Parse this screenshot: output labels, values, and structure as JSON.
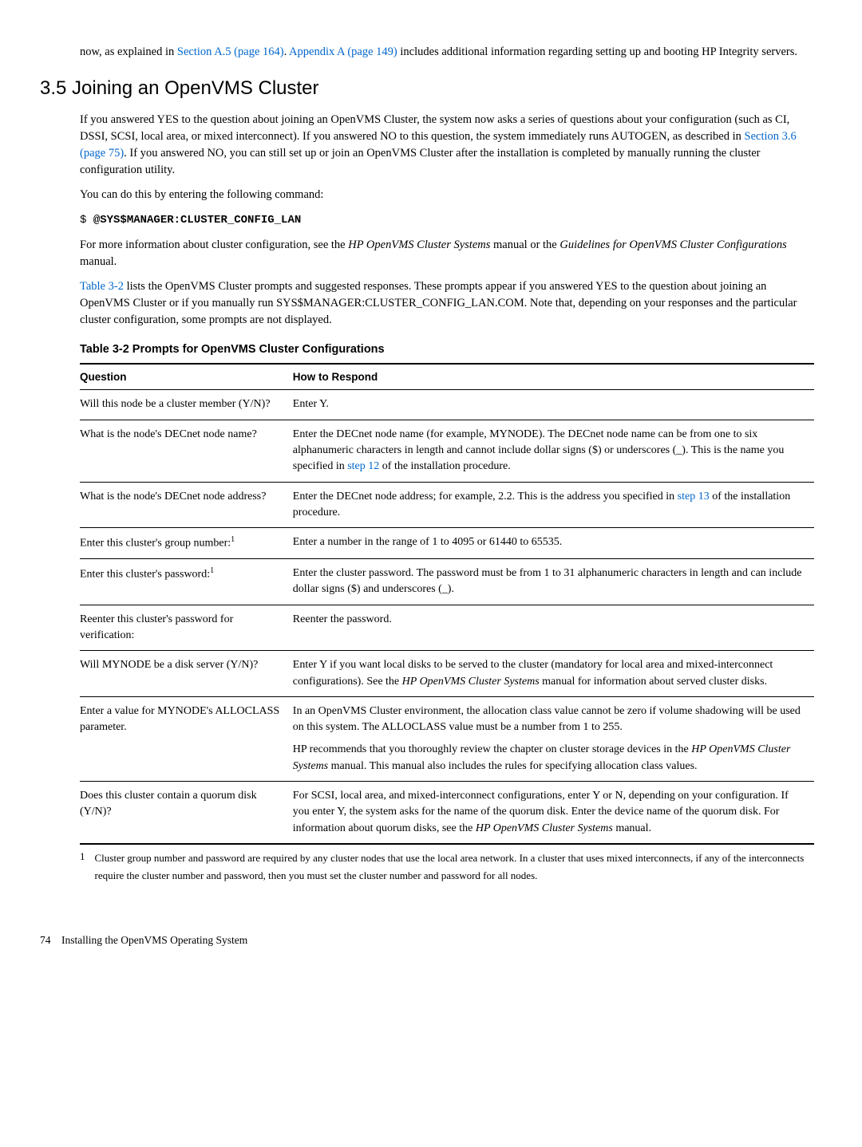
{
  "intro_top": {
    "t1": "now, as explained in ",
    "link1": "Section A.5 (page 164)",
    "t2": ". ",
    "link2": "Appendix A (page 149)",
    "t3": " includes additional information regarding setting up and booting HP Integrity servers."
  },
  "section": {
    "title": "3.5 Joining an OpenVMS Cluster",
    "p1_a": "If you answered YES to the question about joining an OpenVMS Cluster, the system now asks a series of questions about your configuration (such as CI, DSSI, SCSI, local area, or mixed interconnect). If you answered NO to this question, the system immediately runs AUTOGEN, as described in ",
    "p1_link": "Section 3.6 (page 75)",
    "p1_b": ". If you answered NO, you can still set up or join an OpenVMS Cluster after the installation is completed by manually running the cluster configuration utility.",
    "p2": "You  can do this by entering the following command:",
    "cmd_prompt": "$ ",
    "cmd_bold": "@SYS$MANAGER:CLUSTER_CONFIG_LAN",
    "p3_a": "For more information about cluster configuration, see the ",
    "p3_em1": "HP OpenVMS Cluster Systems",
    "p3_b": " manual or the ",
    "p3_em2": "Guidelines for OpenVMS Cluster Configurations",
    "p3_c": " manual.",
    "p4_link": "Table 3-2",
    "p4_a": " lists the OpenVMS Cluster prompts and suggested responses. These prompts appear if you answered YES to the question about joining an OpenVMS Cluster or if you manually run SYS$MANAGER:CLUSTER_CONFIG_LAN.COM. Note that, depending on your responses and the particular cluster configuration, some prompts are not displayed."
  },
  "table": {
    "title": "Table  3-2  Prompts for OpenVMS Cluster Configurations",
    "head_q": "Question",
    "head_r": "How to Respond",
    "rows": [
      {
        "q": "Will this node be a cluster member (Y/N)?",
        "r": "Enter Y."
      },
      {
        "q": "What is the node's DECnet node name?",
        "r_a": "Enter the DECnet node name (for example, MYNODE). The DECnet node name can be from one to six alphanumeric characters in length and cannot include dollar signs ($) or underscores (_). This is the name you specified in ",
        "r_link": "step 12",
        "r_b": " of the installation procedure."
      },
      {
        "q": "What is the node's DECnet node address?",
        "r_a": "Enter the DECnet node address; for example, 2.2. This is the address you specified in ",
        "r_link": "step 13",
        "r_b": " of the installation procedure."
      },
      {
        "q": "Enter this cluster's group number:",
        "fn": "1",
        "r": "Enter a number in the range of 1 to 4095 or 61440 to 65535."
      },
      {
        "q": "Enter this cluster's password:",
        "fn": "1",
        "r": "Enter the cluster password. The password must be from 1 to 31 alphanumeric characters in length and can include dollar signs ($) and underscores (_)."
      },
      {
        "q": "Reenter this cluster's password for verification:",
        "r": "Reenter the password."
      },
      {
        "q": "Will MYNODE be a disk server (Y/N)?",
        "r_a": "Enter Y if you want local disks to be served to the cluster (mandatory for local area and mixed-interconnect configurations). See the ",
        "r_em": "HP OpenVMS Cluster Systems",
        "r_b": " manual for information about served cluster disks."
      },
      {
        "q": "Enter a value for MYNODE's ALLOCLASS parameter.",
        "r1": "In an OpenVMS Cluster environment, the allocation class value cannot be zero if volume shadowing will be used on this system. The ALLOCLASS value must be a number from 1 to 255.",
        "r2_a": "HP recommends that you thoroughly review the chapter on cluster storage devices in the ",
        "r2_em": "HP OpenVMS Cluster Systems",
        "r2_b": " manual. This manual also includes the rules for specifying allocation class values."
      },
      {
        "q": "Does this cluster contain a quorum disk (Y/N)?",
        "r_a": "For SCSI, local area, and mixed-interconnect configurations, enter Y or N, depending on your configuration. If you enter Y, the system asks for the name of the quorum disk. Enter the device name of the quorum disk. For information about quorum disks, see the ",
        "r_em": "HP OpenVMS Cluster Systems",
        "r_b": " manual."
      }
    ]
  },
  "footnote": {
    "num": "1",
    "text": "Cluster group number and password are required by any cluster nodes that use the local area network. In a cluster that uses mixed interconnects, if any of the interconnects require the cluster number and password, then you must set the cluster number and password for all nodes."
  },
  "footer": {
    "page": "74",
    "label": "Installing the OpenVMS Operating System"
  }
}
